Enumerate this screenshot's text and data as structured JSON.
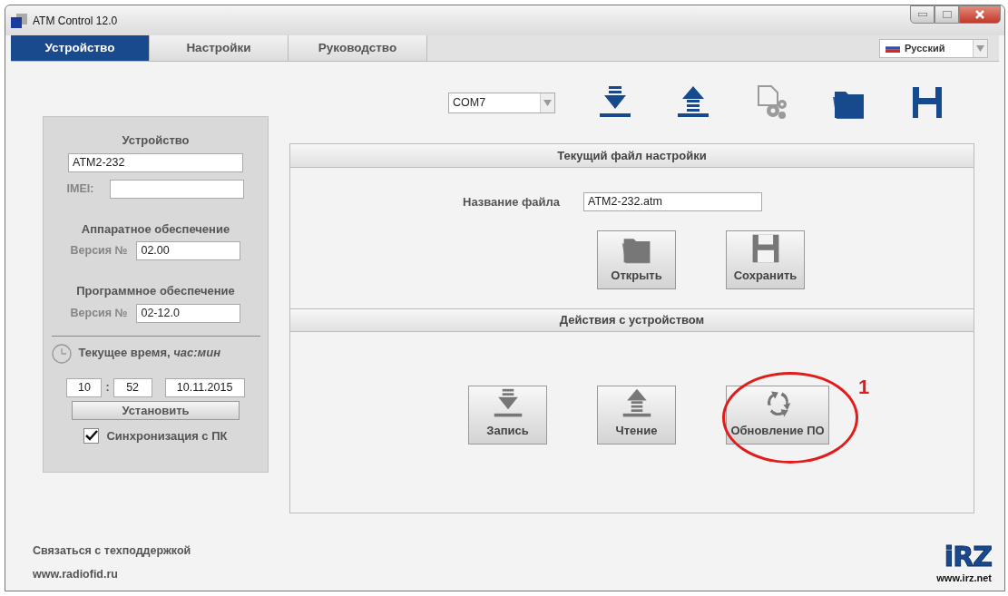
{
  "window": {
    "title": "ATM Control 12.0"
  },
  "tabs": [
    {
      "label": "Устройство",
      "selected": true
    },
    {
      "label": "Настройки",
      "selected": false
    },
    {
      "label": "Руководство",
      "selected": false
    }
  ],
  "language": {
    "value": "Русский"
  },
  "device_panel": {
    "title": "Устройство",
    "device_name": "ATM2-232",
    "imei_label": "IMEI:",
    "hardware_title": "Аппаратное обеспечение",
    "hardware_version_label": "Версия №",
    "hardware_version": "02.00",
    "software_title": "Программное обеспечение",
    "software_version_label": "Версия №",
    "software_version": "02-12.0",
    "time_label": "Текущее время, *час:мин*",
    "hours": "10",
    "time_separator": ":",
    "minutes": "52",
    "date": "10.11.2015",
    "set_button": "Установить",
    "sync": {
      "label": "Синхронизация с ПК",
      "checked": true
    }
  },
  "toolbar": {
    "port": "COM7",
    "buttons": [
      {
        "kind": "download",
        "disabled": false
      },
      {
        "kind": "upload",
        "disabled": false
      },
      {
        "kind": "file-settings",
        "disabled": true
      },
      {
        "kind": "folder",
        "disabled": false
      },
      {
        "kind": "save",
        "disabled": false
      }
    ]
  },
  "settings_section": {
    "title": "Текущий файл настройки",
    "file_label": "Название файла",
    "file_name": "ATM2-232.atm",
    "buttons": [
      {
        "kind": "open",
        "label": "Открыть"
      },
      {
        "kind": "save",
        "label": "Сохранить"
      }
    ]
  },
  "actions_section": {
    "title": "Действия с устройством",
    "buttons": [
      {
        "kind": "write",
        "label": "Запись"
      },
      {
        "kind": "read",
        "label": "Чтение"
      },
      {
        "kind": "update",
        "label": "Обновление ПО",
        "callout": "1"
      }
    ]
  },
  "footer": {
    "support": "Связаться с техподдержкой",
    "website": "www.radiofid.ru",
    "logo_text": "iRZ",
    "logo_url": "www.irz.net"
  }
}
